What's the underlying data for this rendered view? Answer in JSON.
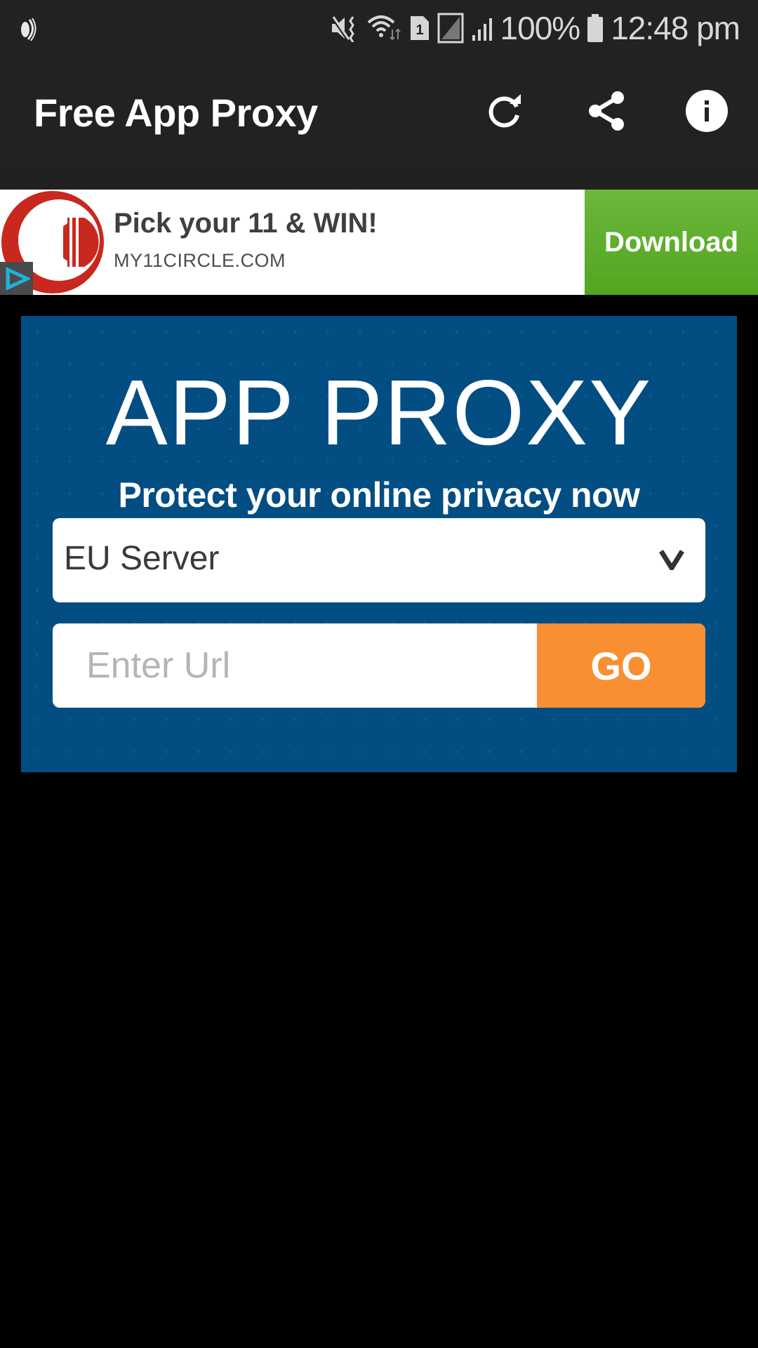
{
  "status_bar": {
    "notification_icon": "app-notification-icon",
    "icons": [
      "mute-vibrate-icon",
      "wifi-data-icon",
      "sim-1-icon",
      "no-signal-sim-icon",
      "signal-bars-icon"
    ],
    "battery_percent": "100%",
    "battery_level": 1.0,
    "time": "12:48 pm"
  },
  "toolbar": {
    "title": "Free App Proxy",
    "actions": [
      {
        "name": "refresh",
        "icon": "refresh-icon"
      },
      {
        "name": "share",
        "icon": "share-icon"
      },
      {
        "name": "info",
        "icon": "info-icon"
      }
    ]
  },
  "ad": {
    "headline": "Pick your 11 & WIN!",
    "domain": "MY11CIRCLE.COM",
    "cta": "Download",
    "logo_icon": "my11circle-logo-icon",
    "adchoices_icon": "adchoices-icon",
    "colors": {
      "cta": "#5aae2a",
      "logo": "#c8281e"
    }
  },
  "proxy_panel": {
    "title": "APP PROXY",
    "subtitle": "Protect your online privacy now",
    "server_select": {
      "selected": "EU Server",
      "chevron_icon": "chevron-down-icon"
    },
    "url_input": {
      "value": "",
      "placeholder": "Enter Url"
    },
    "go_button": "GO",
    "colors": {
      "panel": "#024d82",
      "go": "#f98f33"
    }
  }
}
